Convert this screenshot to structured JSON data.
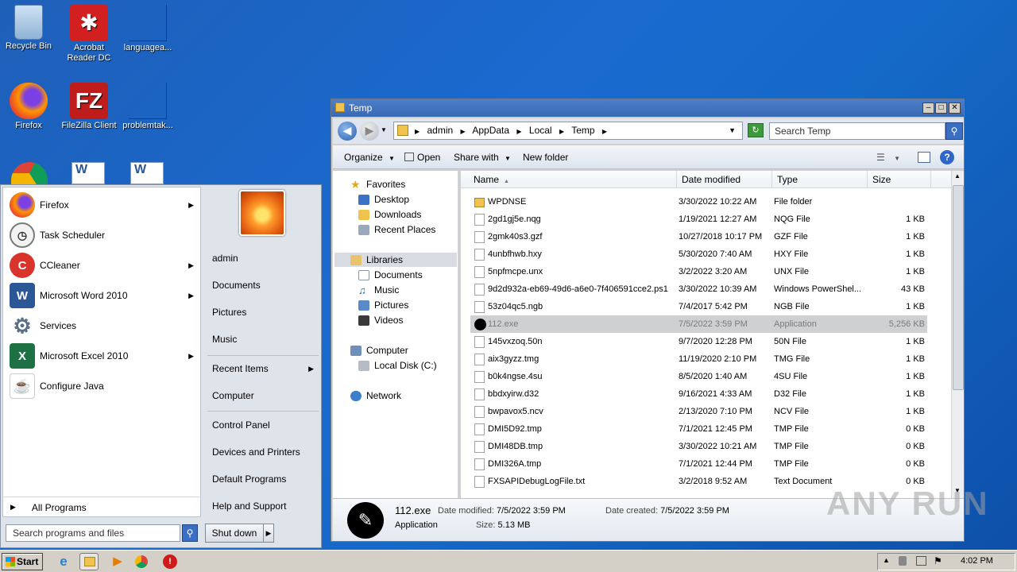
{
  "desktop": {
    "icons": [
      {
        "label": "Recycle Bin"
      },
      {
        "label": "Acrobat Reader DC"
      },
      {
        "label": "languagea..."
      },
      {
        "label": "Firefox"
      },
      {
        "label": "FileZilla Client"
      },
      {
        "label": "problemtak..."
      }
    ]
  },
  "start_menu": {
    "programs": [
      {
        "label": "Firefox",
        "has_submenu": true
      },
      {
        "label": "Task Scheduler",
        "has_submenu": false
      },
      {
        "label": "CCleaner",
        "has_submenu": true
      },
      {
        "label": "Microsoft Word 2010",
        "has_submenu": true
      },
      {
        "label": "Services",
        "has_submenu": false
      },
      {
        "label": "Microsoft Excel 2010",
        "has_submenu": true
      },
      {
        "label": "Configure Java",
        "has_submenu": false
      }
    ],
    "all_programs": "All Programs",
    "search_placeholder": "Search programs and files",
    "right_items": {
      "admin": "admin",
      "documents": "Documents",
      "pictures": "Pictures",
      "music": "Music",
      "recent_items": "Recent Items",
      "computer": "Computer",
      "control_panel": "Control Panel",
      "devices_printers": "Devices and Printers",
      "default_programs": "Default Programs",
      "help_support": "Help and Support"
    },
    "shutdown": "Shut down"
  },
  "explorer": {
    "title": "Temp",
    "breadcrumb": [
      "admin",
      "AppData",
      "Local",
      "Temp"
    ],
    "search_placeholder": "Search Temp",
    "commands": {
      "organize": "Organize",
      "open": "Open",
      "share_with": "Share with",
      "new_folder": "New folder"
    },
    "nav": {
      "favorites": "Favorites",
      "desktop": "Desktop",
      "downloads": "Downloads",
      "recent_places": "Recent Places",
      "libraries": "Libraries",
      "documents": "Documents",
      "music": "Music",
      "pictures": "Pictures",
      "videos": "Videos",
      "computer": "Computer",
      "local_disk": "Local Disk (C:)",
      "network": "Network"
    },
    "columns": {
      "name": "Name",
      "date": "Date modified",
      "type": "Type",
      "size": "Size"
    },
    "files": [
      {
        "name": "WPDNSE",
        "date": "3/30/2022 10:22 AM",
        "type": "File folder",
        "size": ""
      },
      {
        "name": "2gd1gj5e.nqg",
        "date": "1/19/2021 12:27 AM",
        "type": "NQG File",
        "size": "1 KB"
      },
      {
        "name": "2gmk40s3.gzf",
        "date": "10/27/2018 10:17 PM",
        "type": "GZF File",
        "size": "1 KB"
      },
      {
        "name": "4unbfhwb.hxy",
        "date": "5/30/2020 7:40 AM",
        "type": "HXY File",
        "size": "1 KB"
      },
      {
        "name": "5npfmcpe.unx",
        "date": "3/2/2022 3:20 AM",
        "type": "UNX File",
        "size": "1 KB"
      },
      {
        "name": "9d2d932a-eb69-49d6-a6e0-7f406591cce2.ps1",
        "date": "3/30/2022 10:39 AM",
        "type": "Windows PowerShel...",
        "size": "43 KB"
      },
      {
        "name": "53z04qc5.ngb",
        "date": "7/4/2017 5:42 PM",
        "type": "NGB File",
        "size": "1 KB"
      },
      {
        "name": "112.exe",
        "date": "7/5/2022 3:59 PM",
        "type": "Application",
        "size": "5,256 KB"
      },
      {
        "name": "145vxzoq.50n",
        "date": "9/7/2020 12:28 PM",
        "type": "50N File",
        "size": "1 KB"
      },
      {
        "name": "aix3gyzz.tmg",
        "date": "11/19/2020 2:10 PM",
        "type": "TMG File",
        "size": "1 KB"
      },
      {
        "name": "b0k4ngse.4su",
        "date": "8/5/2020 1:40 AM",
        "type": "4SU File",
        "size": "1 KB"
      },
      {
        "name": "bbdxyirw.d32",
        "date": "9/16/2021 4:33 AM",
        "type": "D32 File",
        "size": "1 KB"
      },
      {
        "name": "bwpavox5.ncv",
        "date": "2/13/2020 7:10 PM",
        "type": "NCV File",
        "size": "1 KB"
      },
      {
        "name": "DMI5D92.tmp",
        "date": "7/1/2021 12:45 PM",
        "type": "TMP File",
        "size": "0 KB"
      },
      {
        "name": "DMI48DB.tmp",
        "date": "3/30/2022 10:21 AM",
        "type": "TMP File",
        "size": "0 KB"
      },
      {
        "name": "DMI326A.tmp",
        "date": "7/1/2021 12:44 PM",
        "type": "TMP File",
        "size": "0 KB"
      },
      {
        "name": "FXSAPIDebugLogFile.txt",
        "date": "3/2/2018 9:52 AM",
        "type": "Text Document",
        "size": "0 KB"
      }
    ],
    "details": {
      "name": "112.exe",
      "type": "Application",
      "modified_label": "Date modified:",
      "modified": "7/5/2022 3:59 PM",
      "created_label": "Date created:",
      "created": "7/5/2022 3:59 PM",
      "size_label": "Size:",
      "size": "5.13 MB"
    }
  },
  "taskbar": {
    "start": "Start",
    "clock": "4:02 PM"
  },
  "watermark": "ANY RUN"
}
